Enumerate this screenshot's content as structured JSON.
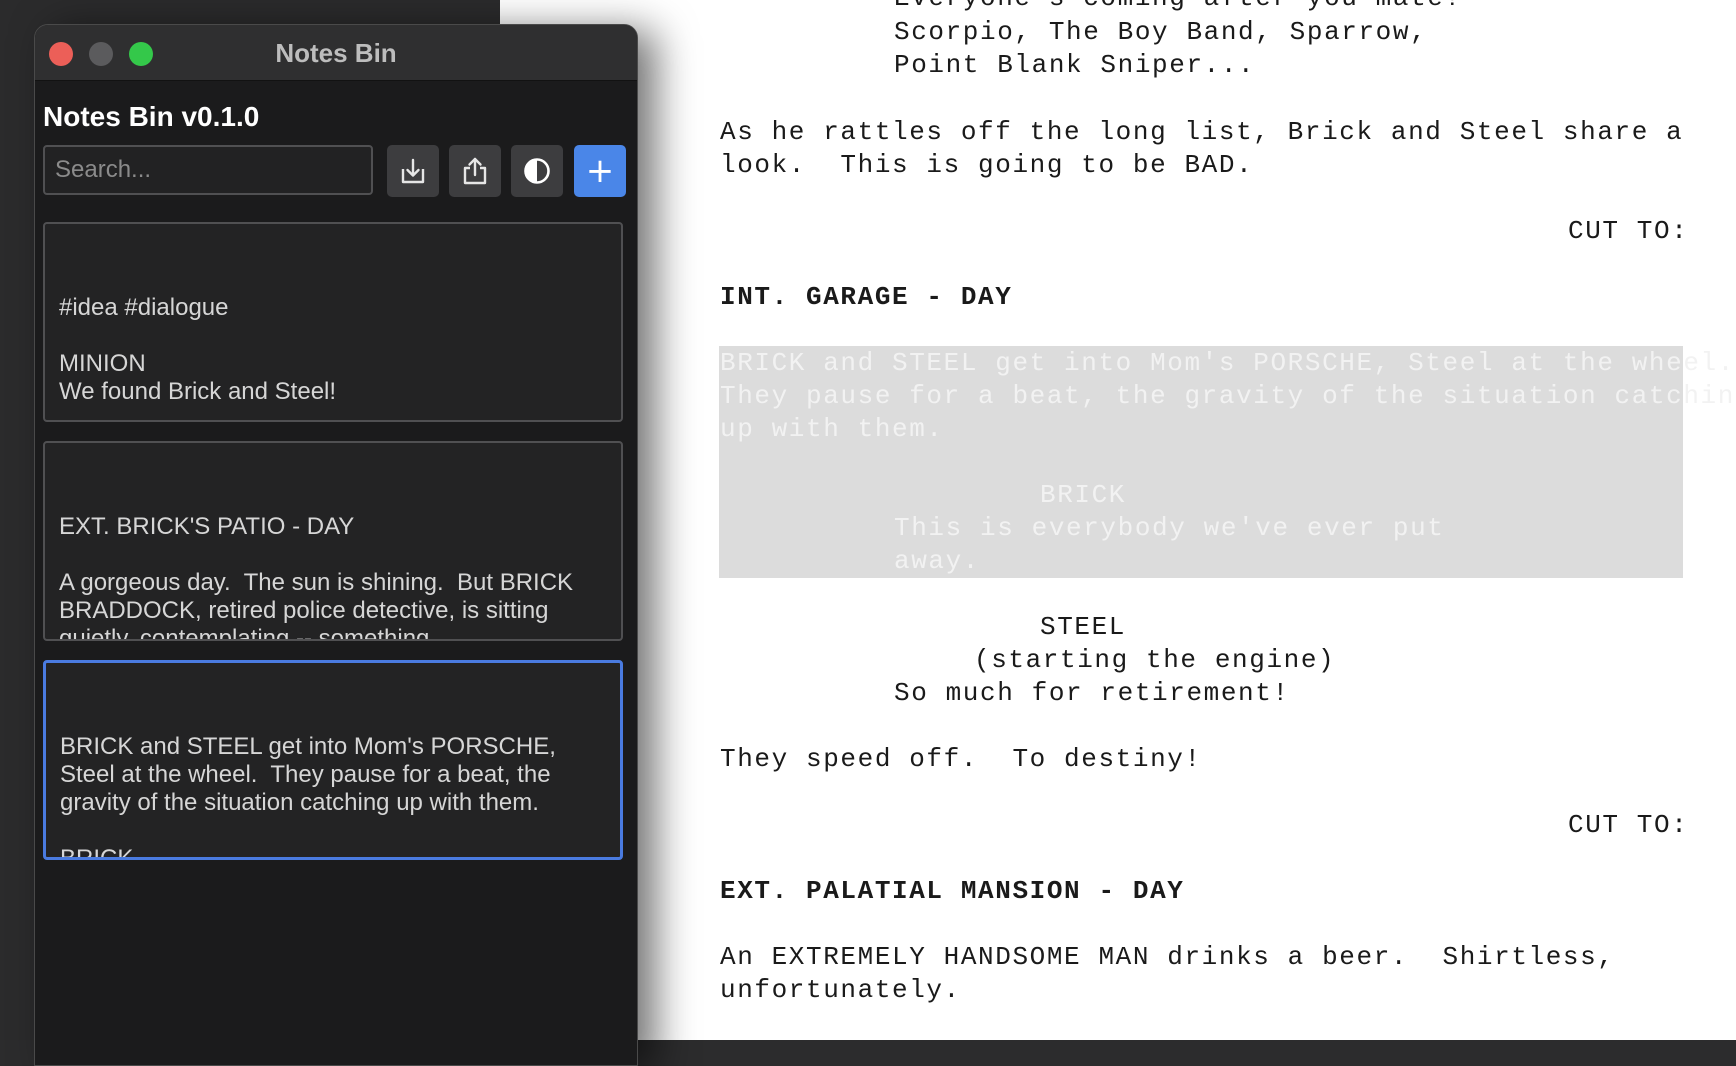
{
  "window": {
    "title": "Notes Bin"
  },
  "app": {
    "title": "Notes Bin v0.1.0"
  },
  "search": {
    "placeholder": "Search...",
    "value": ""
  },
  "toolbar": {
    "import_icon": "import-icon",
    "export_icon": "share-icon",
    "theme_icon": "contrast-icon",
    "add_label": "+"
  },
  "colors": {
    "accent": "#4a86e8",
    "selected_border": "#4a7be0",
    "close": "#ec5f58",
    "zoom": "#34c84a"
  },
  "notes": [
    {
      "text": "#idea #dialogue\n\nMINION\nWe found Brick and Steel!\n\nHANDSOME MAN\nI want them dead.  DEAD!"
    },
    {
      "text": "EXT. BRICK'S PATIO - DAY\n\nA gorgeous day.  The sun is shining.  But BRICK BRADDOCK, retired police detective, is sitting quietly, contemplating -- something.\n\nThe SCREEN DOOR slides open and DICK"
    },
    {
      "text": "BRICK and STEEL get into Mom's PORSCHE, Steel at the wheel.  They pause for a beat, the gravity of the situation catching up with them.\n\nBRICK\nThis is everybody we've ever put away.",
      "selected": true
    }
  ],
  "script": {
    "line_top": "Everyone's coming after you mate!",
    "line_1": "Scorpio, The Boy Band, Sparrow,",
    "line_2": "Point Blank Sniper...",
    "action_1a": "As he rattles off the long list, Brick and Steel share a",
    "action_1b": "look.  This is going to be BAD.",
    "transition_1": "CUT TO:",
    "scene_1": "INT. GARAGE - DAY",
    "sel_action_a": "BRICK and STEEL get into Mom's PORSCHE, Steel at the wheel.",
    "sel_action_b": "They pause for a beat, the gravity of the situation catching",
    "sel_action_c": "up with them.",
    "sel_character": "BRICK",
    "sel_dialogue_a": "This is everybody we've ever put",
    "sel_dialogue_b": "away.",
    "character_2": "STEEL",
    "paren_2": "(starting the engine)",
    "dialogue_2": "So much for retirement!",
    "action_2": "They speed off.  To destiny!",
    "transition_2": "CUT TO:",
    "scene_2": "EXT. PALATIAL MANSION - DAY",
    "action_3a": "An EXTREMELY HANDSOME MAN drinks a beer.  Shirtless,",
    "action_3b": "unfortunately."
  }
}
